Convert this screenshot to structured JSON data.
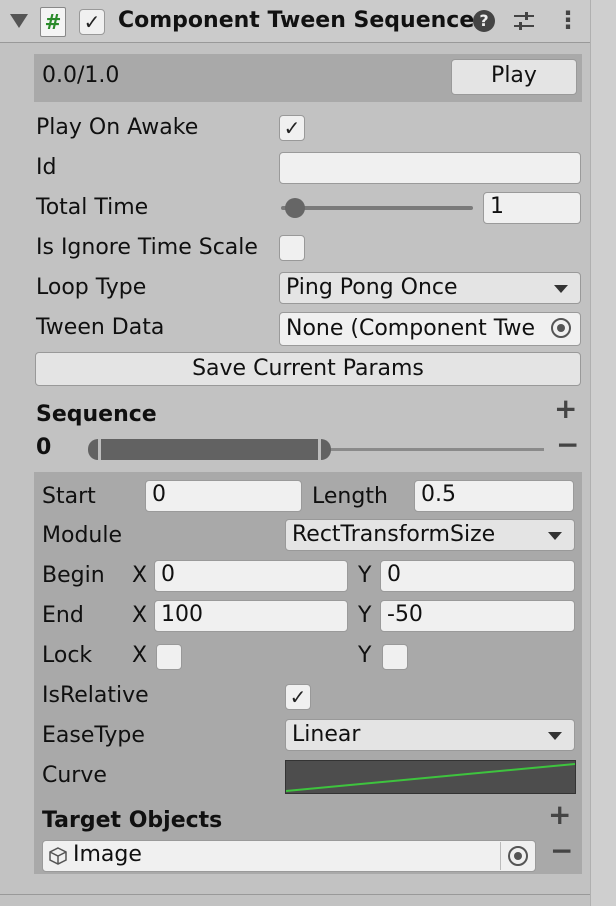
{
  "header": {
    "title": "Component Tween Sequence",
    "script_icon": "#",
    "enabled_check": "✓",
    "help_icon": "?",
    "presets_icon": "sliders",
    "menu_icon": "⋮"
  },
  "top": {
    "progress": "0.0/1.0",
    "play_label": "Play"
  },
  "props": {
    "play_on_awake": "Play On Awake",
    "play_on_awake_check": "✓",
    "id": "Id",
    "id_value": "",
    "total_time": "Total Time",
    "total_time_value": "1",
    "ignore_time_scale": "Is Ignore Time Scale",
    "loop_type": "Loop Type",
    "loop_type_value": "Ping Pong Once",
    "tween_data": "Tween Data",
    "tween_data_value": "None (Component Twe",
    "save_label": "Save Current Params"
  },
  "sequence": {
    "title": "Sequence",
    "index": "0",
    "add": "+",
    "remove": "−"
  },
  "item": {
    "start_label": "Start",
    "start_value": "0",
    "length_label": "Length",
    "length_value": "0.5",
    "module_label": "Module",
    "module_value": "RectTransformSize",
    "begin_label": "Begin",
    "begin_x": "0",
    "begin_y": "0",
    "end_label": "End",
    "end_x": "100",
    "end_y": "-50",
    "lock_label": "Lock",
    "x_label": "X",
    "y_label": "Y",
    "isrelative_label": "IsRelative",
    "isrelative_check": "✓",
    "easetype_label": "EaseType",
    "easetype_value": "Linear",
    "curve_label": "Curve",
    "targets_title": "Target Objects",
    "target_value": "Image",
    "add": "+",
    "remove": "−"
  }
}
